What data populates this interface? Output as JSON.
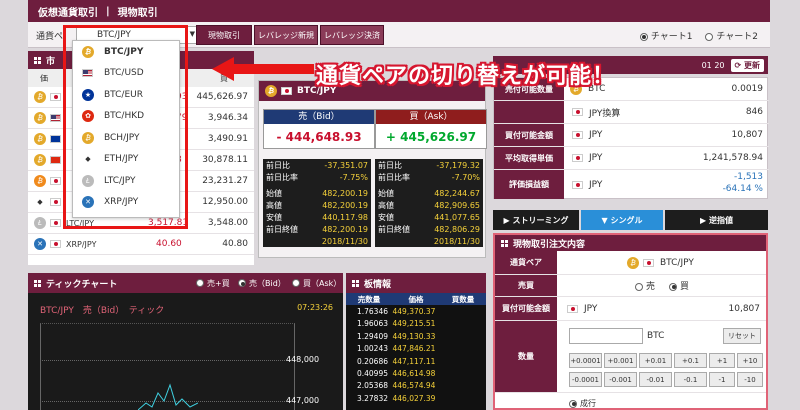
{
  "nav": {
    "items": [
      "仮想通貨取引",
      "現物取引"
    ]
  },
  "toolbar": {
    "pair_label": "通貨ペ",
    "pair_value": "BTC/JPY",
    "tabs": [
      "現物取引",
      "レバレッジ新規",
      "レバレッジ決済"
    ],
    "chart1": "チャート1",
    "chart2": "チャート2"
  },
  "market": {
    "header_title": "市",
    "col_header": "価",
    "col_buy": "買",
    "rows": [
      {
        "sell": "93",
        "buy": "445,626.97"
      },
      {
        "sell": "79",
        "buy": "3,946.34"
      },
      {
        "sell": "",
        "buy": "3,490.91"
      },
      {
        "sell": "8",
        "buy": "30,878.11"
      },
      {
        "sell": "",
        "buy": "23,231.27"
      },
      {
        "sell": "",
        "buy": "12,950.00"
      },
      {
        "pair": "LTC/JPY",
        "sell": "3,517.81",
        "buy": "3,548.00"
      },
      {
        "pair": "XRP/JPY",
        "sell": "40.60",
        "buy": "40.80"
      }
    ]
  },
  "dropdown": {
    "items": [
      "BTC/JPY",
      "BTC/USD",
      "BTC/EUR",
      "BTC/HKD",
      "BCH/JPY",
      "ETH/JPY",
      "LTC/JPY",
      "XRP/JPY"
    ]
  },
  "banner": {
    "text": "通貨ペアの切り替えが可能！"
  },
  "btc": {
    "pair": "BTC/JPY",
    "bid_label": "売（Bid）",
    "ask_label": "買（Ask）",
    "bid_price": "444,648.93",
    "ask_price": "445,626.97",
    "bid_stats": [
      {
        "k": "前日比",
        "v": "-37,351.07"
      },
      {
        "k": "前日比率",
        "v": "-7.75%"
      },
      {
        "k": "始値",
        "v": "482,200.19"
      },
      {
        "k": "高値",
        "v": "482,200.19"
      },
      {
        "k": "安値",
        "v": "440,117.98"
      },
      {
        "k": "前日終値",
        "v": "482,200.19"
      },
      {
        "k": "",
        "v": "2018/11/30"
      }
    ],
    "ask_stats": [
      {
        "k": "前日比",
        "v": "-37,179.32"
      },
      {
        "k": "前日比率",
        "v": "-7.70%"
      },
      {
        "k": "始値",
        "v": "482,244.67"
      },
      {
        "k": "高値",
        "v": "482,909.65"
      },
      {
        "k": "安値",
        "v": "441,077.65"
      },
      {
        "k": "前日終値",
        "v": "482,806.29"
      },
      {
        "k": "",
        "v": "2018/11/30"
      }
    ]
  },
  "top_right": {
    "time": "01 20",
    "refresh": "更新"
  },
  "account": {
    "rows": [
      {
        "label": "売付可能数量",
        "cur": "BTC",
        "value": "0.0019"
      },
      {
        "label": "",
        "cur": "JPY換算",
        "value": "846"
      },
      {
        "label": "買付可能金額",
        "cur": "JPY",
        "value": "10,807"
      },
      {
        "label": "平均取得単価",
        "cur": "JPY",
        "value": "1,241,578.94"
      },
      {
        "label": "評価損益額",
        "cur": "JPY",
        "value": "-1,513"
      },
      {
        "label": "",
        "cur": "",
        "value": "-64.14 %"
      }
    ]
  },
  "modes": [
    "ストリーミング",
    "シングル",
    "逆指値"
  ],
  "order": {
    "title": "現物取引注文内容",
    "pair_label": "通貨ペア",
    "pair_value": "BTC/JPY",
    "side_label": "売買",
    "sell": "売",
    "buy": "買",
    "funds_label": "買付可能金額",
    "funds_cur": "JPY",
    "funds_value": "10,807",
    "qty_label": "数量",
    "qty_unit": "BTC",
    "reset": "リセット",
    "plus": [
      "+0.0001",
      "+0.001",
      "+0.01",
      "+0.1",
      "+1",
      "+10"
    ],
    "minus": [
      "-0.0001",
      "-0.001",
      "-0.01",
      "-0.1",
      "-1",
      "-10"
    ],
    "market_order": "成行"
  },
  "tick": {
    "title": "ティックチャート",
    "opt1": "売+買",
    "opt2": "売（Bid）",
    "opt3": "買（Ask）",
    "chart_label": "BTC/JPY　売（Bid）　ティック",
    "time": "07:23:26",
    "y_high": "448,000",
    "y_low": "447,000"
  },
  "book": {
    "title": "板情報",
    "cols": [
      "売数量",
      "価格",
      "買数量"
    ],
    "rows": [
      {
        "qty": "1.76346",
        "price": "449,370.37"
      },
      {
        "qty": "1.96063",
        "price": "449,215.51"
      },
      {
        "qty": "1.29409",
        "price": "449,130.33"
      },
      {
        "qty": "1.00243",
        "price": "447,846.21"
      },
      {
        "qty": "0.20686",
        "price": "447,117.11"
      },
      {
        "qty": "0.40995",
        "price": "446,614.98"
      },
      {
        "qty": "2.05368",
        "price": "446,574.94"
      },
      {
        "qty": "3.27832",
        "price": "446,027.39"
      }
    ]
  },
  "colors": {
    "brand": "#6e1e3e",
    "accent_red": "#e81616",
    "bid_red": "#c8102e",
    "ask_green": "#00a82d",
    "gold": "#f6d23a"
  }
}
